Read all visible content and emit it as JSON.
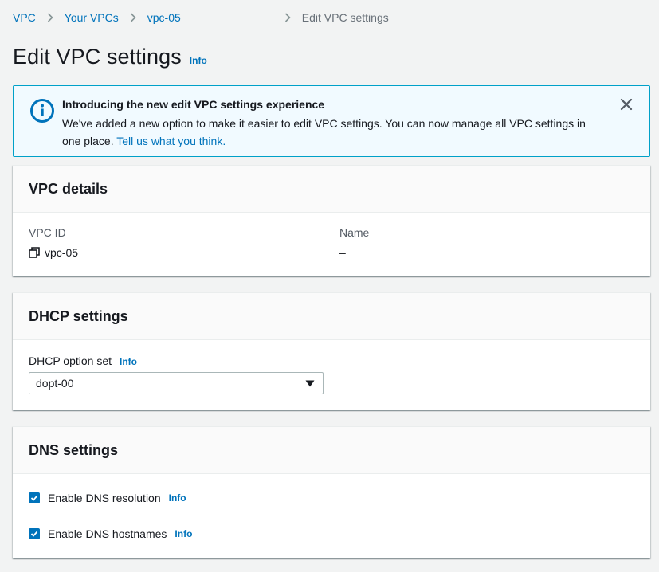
{
  "breadcrumb": {
    "items": [
      "VPC",
      "Your VPCs",
      "vpc-05"
    ],
    "current": "Edit VPC settings"
  },
  "page": {
    "title": "Edit VPC settings",
    "info": "Info"
  },
  "flash": {
    "title": "Introducing the new edit VPC settings experience",
    "body": "We've added a new option to make it easier to edit VPC settings. You can now manage all VPC settings in one place.",
    "link": "Tell us what you think."
  },
  "vpc_details": {
    "title": "VPC details",
    "vpc_id_label": "VPC ID",
    "vpc_id_value": "vpc-05",
    "name_label": "Name",
    "name_value": "–"
  },
  "dhcp": {
    "title": "DHCP settings",
    "option_set_label": "DHCP option set",
    "info": "Info",
    "selected": "dopt-00"
  },
  "dns": {
    "title": "DNS settings",
    "resolution_label": "Enable DNS resolution",
    "hostnames_label": "Enable DNS hostnames",
    "info": "Info",
    "resolution_checked": true,
    "hostnames_checked": true
  },
  "colors": {
    "link": "#0073bb",
    "info_border": "#00a1c9",
    "info_bg": "#f1faff",
    "checkbox": "#0073bb"
  },
  "icons": {
    "flash": "info-circle-icon",
    "close": "close-icon",
    "copy": "copy-icon",
    "caret": "caret-down-icon",
    "chevron": "chevron-right-icon",
    "check": "checkmark-icon"
  }
}
